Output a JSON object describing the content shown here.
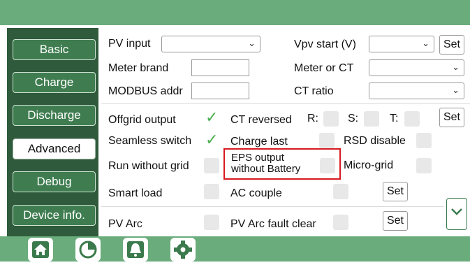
{
  "sidebar": {
    "items": [
      {
        "label": "Basic"
      },
      {
        "label": "Charge"
      },
      {
        "label": "Discharge"
      },
      {
        "label": "Advanced"
      },
      {
        "label": "Debug"
      },
      {
        "label": "Device info."
      }
    ]
  },
  "form": {
    "pv_input": {
      "label": "PV input",
      "value": ""
    },
    "vpv_start": {
      "label": "Vpv start (V)",
      "value": "",
      "set": "Set"
    },
    "meter_brand": {
      "label": "Meter brand",
      "value": ""
    },
    "meter_or_ct": {
      "label": "Meter or CT",
      "value": ""
    },
    "modbus_addr": {
      "label": "MODBUS addr",
      "value": ""
    },
    "ct_ratio": {
      "label": "CT ratio",
      "value": ""
    },
    "offgrid_output": {
      "label": "Offgrid output",
      "checked": true
    },
    "ct_reversed": {
      "label": "CT reversed",
      "r": "R:",
      "s": "S:",
      "t": "T:",
      "set": "Set"
    },
    "seamless_switch": {
      "label": "Seamless switch",
      "checked": true
    },
    "charge_last": {
      "label": "Charge last",
      "checked": false
    },
    "rsd_disable": {
      "label": "RSD disable",
      "checked": false
    },
    "run_without_grid": {
      "label": "Run without grid",
      "checked": false
    },
    "eps_output": {
      "label1": "EPS output",
      "label2": "without Battery",
      "checked": false
    },
    "micro_grid": {
      "label": "Micro-grid",
      "checked": false
    },
    "smart_load": {
      "label": "Smart load",
      "checked": false
    },
    "ac_couple": {
      "label": "AC couple",
      "checked": false,
      "set": "Set"
    },
    "pv_arc": {
      "label": "PV Arc",
      "checked": false
    },
    "pv_arc_fault_clear": {
      "label": "PV Arc fault clear",
      "checked": false,
      "set": "Set"
    }
  },
  "colors": {
    "top_bar": "#6aac7c",
    "sidebar": "#2f5b3c",
    "highlight": "#d71920",
    "check": "#4caf50"
  },
  "bottom_nav": {
    "icons": [
      "home-icon",
      "chart-icon",
      "alarm-icon",
      "settings-icon"
    ]
  }
}
